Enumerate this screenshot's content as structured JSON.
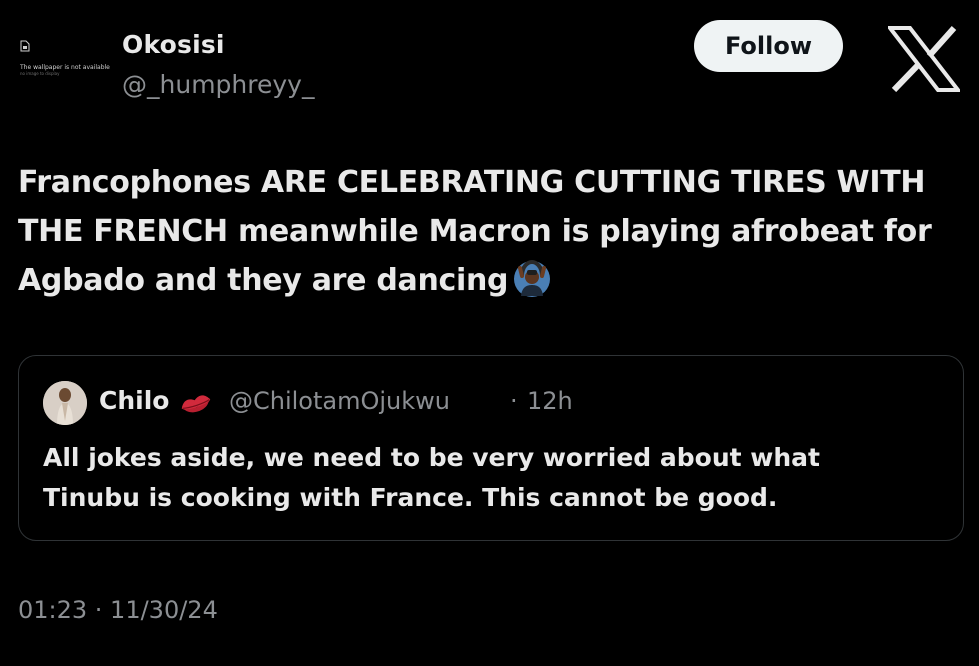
{
  "header": {
    "avatar_text": "The wallpaper is not available",
    "avatar_subtext": "no image to display",
    "display_name": "Okosisi",
    "handle": "@_humphreyy_",
    "follow_label": "Follow",
    "logo_icon": "x-logo-icon"
  },
  "tweet": {
    "text_line1": "Francophones ARE CELEBRATING CUTTING TIRES WITH",
    "text_line2": "THE FRENCH meanwhile Macron is playing afrobeat for",
    "text_line3": "Agbado and they are dancing",
    "emoji_icon": "man-gesturing-ok-icon"
  },
  "quote": {
    "display_name": "Chilo",
    "name_emoji_icon": "kiss-mark-icon",
    "handle": "@ChilotamOjukwu",
    "separator": "·",
    "time": "12h",
    "text_line1": "All jokes aside, we need to be very worried about what",
    "text_line2": "Tinubu is cooking with France. This cannot be good."
  },
  "footer": {
    "timestamp": "01:23 · 11/30/24"
  },
  "colors": {
    "background": "#000000",
    "text": "#e9e9e9",
    "secondary": "#8c8f93",
    "button_bg": "#eff3f4",
    "border": "#2f3336"
  }
}
